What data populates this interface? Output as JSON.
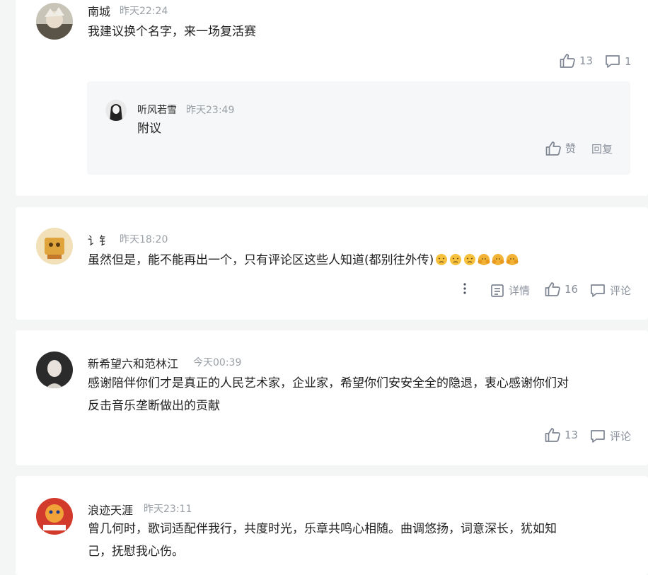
{
  "comments": [
    {
      "name": "南城",
      "time": "昨天22:24",
      "text": "我建议换个名字，来一场复活赛",
      "likes": "13",
      "replies": "1",
      "reply": {
        "name": "听风若雪",
        "time": "昨天23:49",
        "text": "附议",
        "like_label": "赞",
        "reply_label": "回复"
      }
    },
    {
      "name": "讠钅",
      "time": "昨天18:20",
      "text": "虽然但是，能不能再出一个，只有评论区这些人知道(都别往外传)",
      "detail_label": "详情",
      "likes": "16",
      "comment_label": "评论"
    },
    {
      "name": "新希望六和范林江",
      "time": "今天00:39",
      "text_line1": "感谢陪伴你们才是真正的人民艺术家，企业家，希望你们安安全全的隐退，衷心感谢你们对",
      "text_line2": "反击音乐垄断做出的贡献",
      "likes": "13",
      "comment_label": "评论"
    },
    {
      "name": "浪迹天涯",
      "time": "昨天23:11",
      "text_line1": "曾几何时，歌词适配伴我行，共度时光，乐章共鸣心相随。曲调悠扬，词意深长，犹如知",
      "text_line2": "己，抚慰我心伤。"
    }
  ],
  "icons": {
    "like": "thumbs-up-icon",
    "comment": "speech-bubble-icon",
    "more": "more-vertical-icon",
    "detail": "document-icon",
    "emoji_sad": "crying-face-icon",
    "emoji_bow": "bowing-face-icon"
  },
  "colors": {
    "background": "#f4f5f5",
    "card": "#ffffff",
    "reply_box": "#f6f7f8",
    "action_grey": "#8a919c",
    "time_grey": "#9aa0a6"
  }
}
